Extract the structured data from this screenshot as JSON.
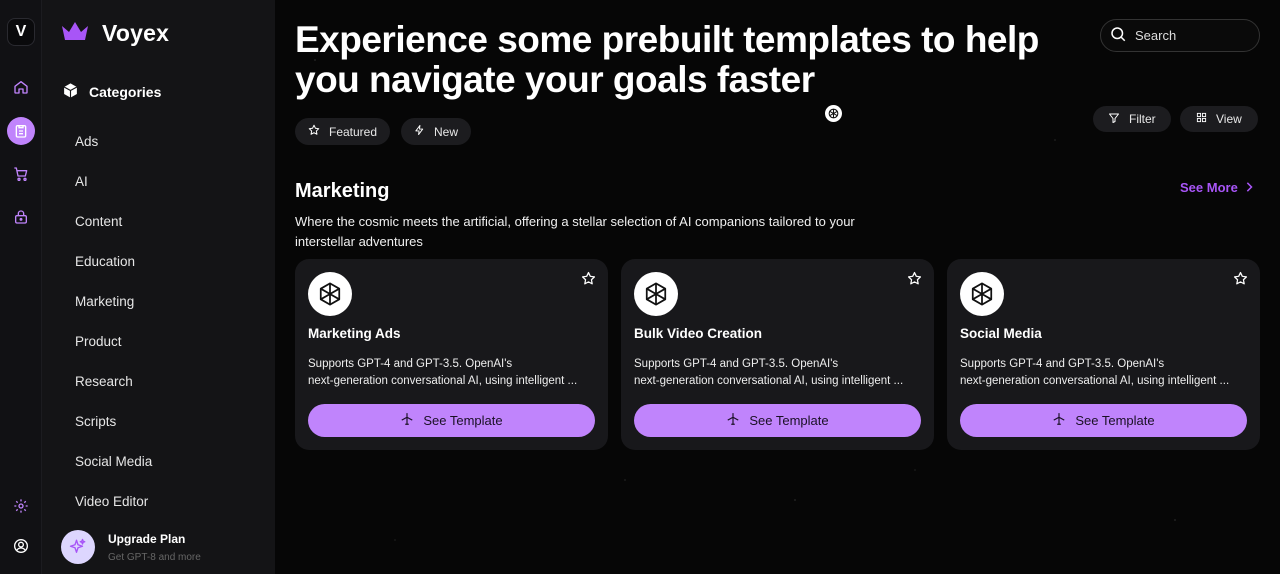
{
  "app": {
    "logo_letter": "V",
    "name": "Voyex",
    "accent_color": "#c084fc"
  },
  "rail": {
    "icons": [
      "home-icon",
      "clipboard-icon",
      "cart-icon",
      "lock-icon",
      "gear-icon",
      "user-circle-icon"
    ],
    "active": "clipboard-icon"
  },
  "sidebar": {
    "heading": "Categories",
    "items": [
      {
        "label": "Ads"
      },
      {
        "label": "AI"
      },
      {
        "label": "Content"
      },
      {
        "label": "Education"
      },
      {
        "label": "Marketing"
      },
      {
        "label": "Product"
      },
      {
        "label": "Research"
      },
      {
        "label": "Scripts"
      },
      {
        "label": "Social Media"
      },
      {
        "label": "Video Editor"
      }
    ],
    "upgrade": {
      "title": "Upgrade Plan",
      "subtitle": "Get GPT-8 and more"
    }
  },
  "header": {
    "headline": "Experience some prebuilt templates to help you navigate your goals faster",
    "search_placeholder": "Search"
  },
  "pills": {
    "featured": "Featured",
    "new": "New",
    "filter": "Filter",
    "view": "View"
  },
  "section": {
    "title": "Marketing",
    "see_more": "See More",
    "description": "Where the cosmic meets the artificial, offering a stellar selection of AI companions tailored to your interstellar adventures"
  },
  "cards": [
    {
      "title": "Marketing Ads",
      "desc_line1": "Supports GPT-4 and GPT-3.5. OpenAI's",
      "desc_line2": "next-generation conversational AI, using intelligent ...",
      "button": "See Template"
    },
    {
      "title": "Bulk Video Creation",
      "desc_line1": "Supports GPT-4 and GPT-3.5. OpenAI's",
      "desc_line2": "next-generation conversational AI, using intelligent ...",
      "button": "See Template"
    },
    {
      "title": "Social Media",
      "desc_line1": "Supports GPT-4 and GPT-3.5. OpenAI's",
      "desc_line2": "next-generation conversational AI, using intelligent ...",
      "button": "See Template"
    }
  ]
}
